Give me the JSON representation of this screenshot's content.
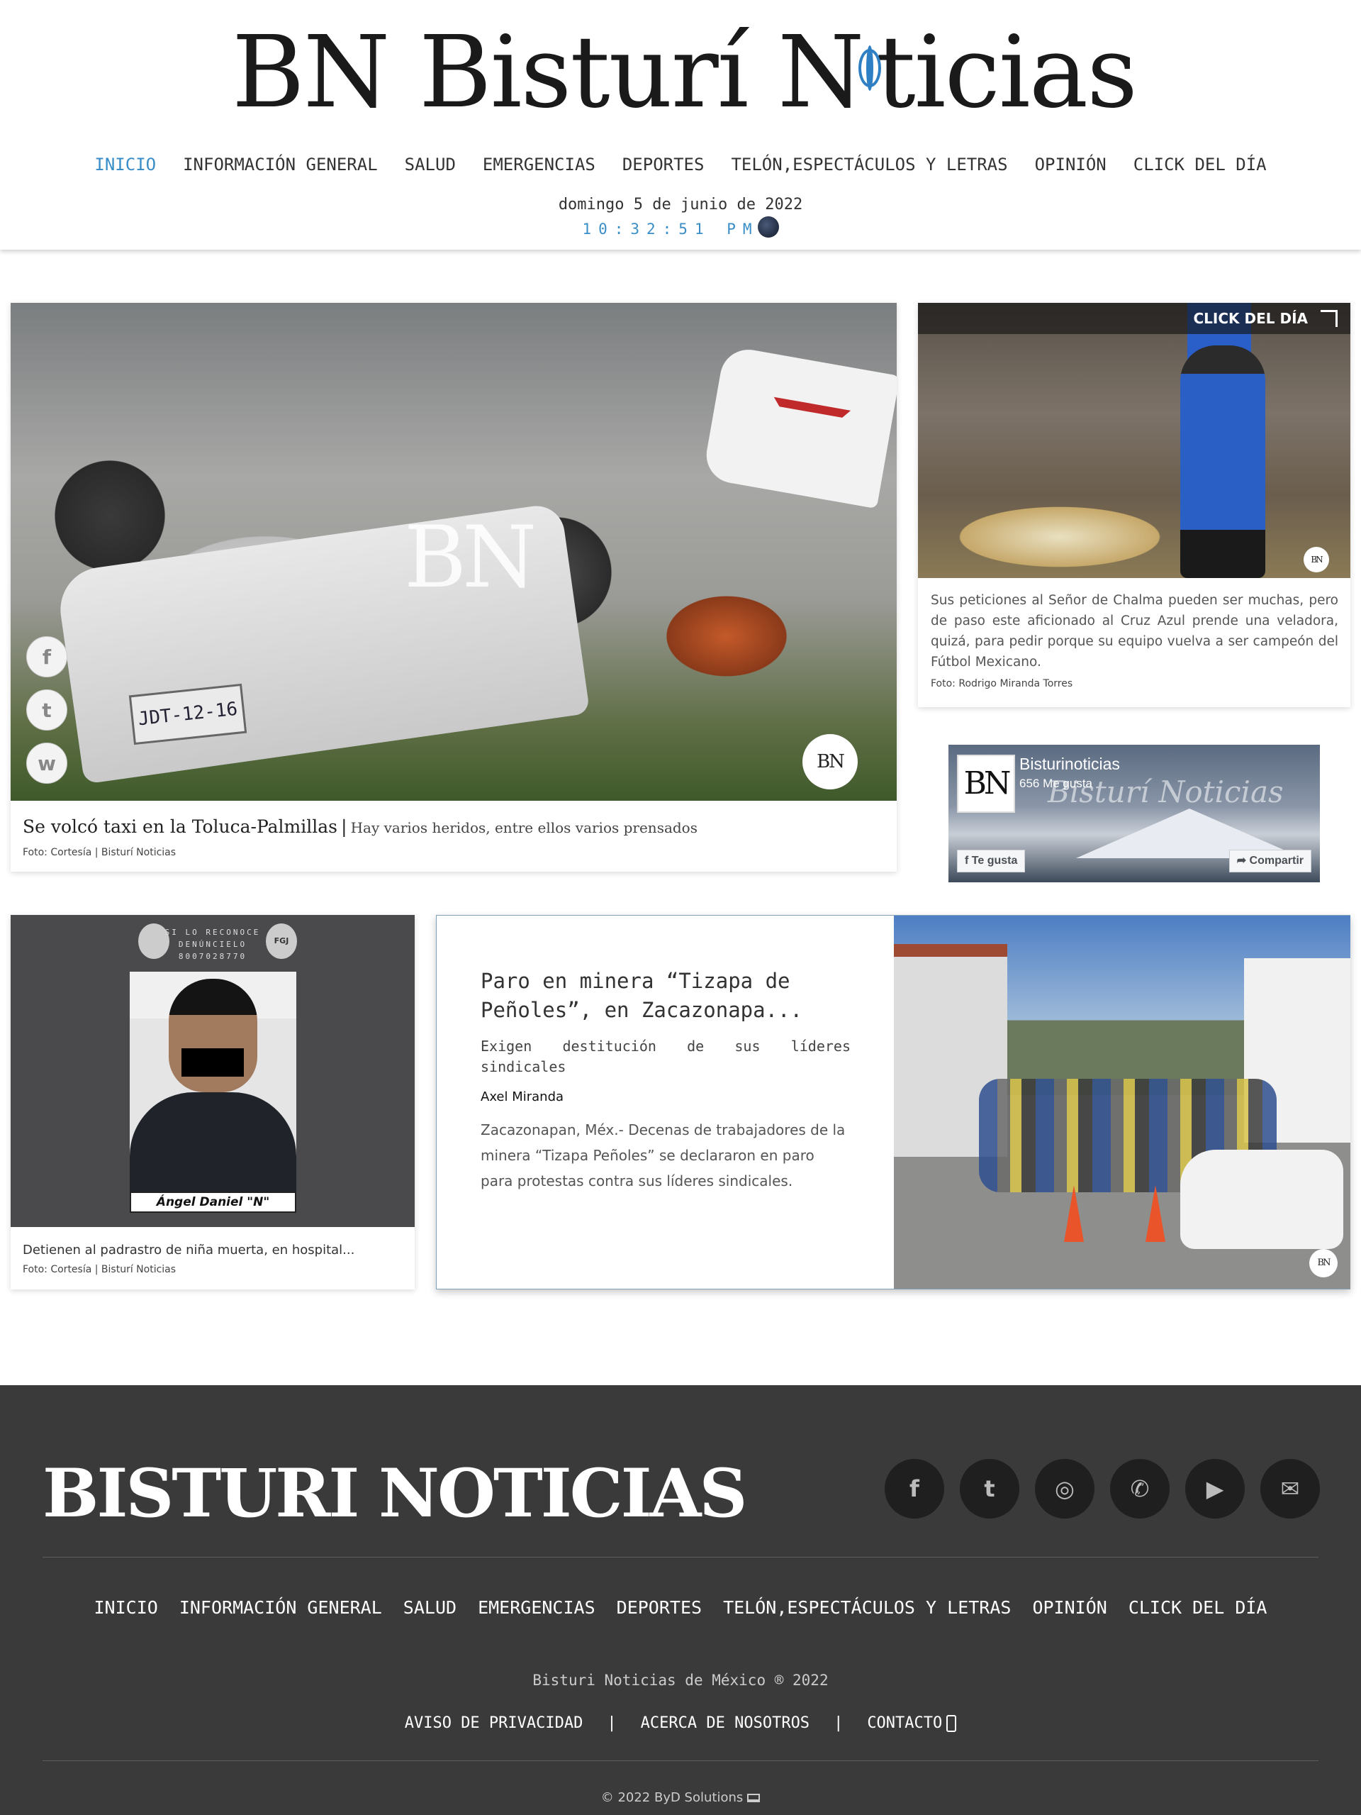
{
  "header": {
    "logo_text_left": "BN Bisturí N",
    "logo_text_right": "ticias",
    "nav": [
      "INICIO",
      "INFORMACIÓN GENERAL",
      "SALUD",
      "EMERGENCIAS",
      "DEPORTES",
      "TELÓN,ESPECTÁCULOS Y LETRAS",
      "OPINIÓN",
      "CLICK DEL DÍA"
    ],
    "date": "domingo 5 de junio de 2022",
    "time": "10:32:51 PM"
  },
  "feature": {
    "title": "Se volcó taxi en la Toluca-Palmillas",
    "separator": "|",
    "subtitle": "Hay varios heridos, entre ellos varios prensados",
    "credit": "Foto: Cortesía | Bisturí Noticias",
    "plate": "JDT-12-16",
    "watermark": "BN",
    "badge": "BN"
  },
  "click_del_dia": {
    "label": "CLICK DEL DÍA",
    "text": "Sus peticiones al Señor de Chalma pueden ser muchas, pero de paso este aficionado al Cruz Azul prende una veladora, quizá, para pedir porque su equipo vuelva a ser campeón del Fútbol Mexicano.",
    "credit": "Foto: Rodrigo Miranda Torres",
    "badge": "BN"
  },
  "facebook": {
    "page_name": "Bisturinoticias",
    "likes": "656 Me gusta",
    "cover_script": "Bisturí Noticias",
    "logo": "BN",
    "like_button": "Te gusta",
    "share_button": "Compartir"
  },
  "arrest": {
    "top_text": "SI LO RECONOCE DENÚNCIELO 8007028770",
    "seal_right": "FGJ",
    "name_tag": "Ángel Daniel \"N\"",
    "caption": "Detienen al padrastro de niña muerta, en hospital...",
    "credit": "Foto: Cortesía | Bisturí Noticias"
  },
  "story": {
    "title": "Paro en minera “Tizapa de Peñoles”, en Zacazonapa...",
    "lead": "Exigen destitución de sus líderes sindicales",
    "author": "Axel Miranda",
    "body": "Zacazonapan, Méx.- Decenas de trabajadores de la minera “Tizapa Peñoles” se declararon en paro para protestas contra sus líderes sindicales.",
    "badge": "BN"
  },
  "footer": {
    "brand": "BISTURI NOTICIAS",
    "socials": [
      "facebook-icon",
      "twitter-icon",
      "instagram-icon",
      "whatsapp-icon",
      "youtube-icon",
      "mail-icon"
    ],
    "nav": [
      "INICIO",
      "INFORMACIÓN GENERAL",
      "SALUD",
      "EMERGENCIAS",
      "DEPORTES",
      "TELÓN,ESPECTÁCULOS Y LETRAS",
      "OPINIÓN",
      "CLICK DEL DÍA"
    ],
    "copyright": "Bisturi Noticias de México ® 2022",
    "links": [
      "AVISO DE PRIVACIDAD",
      "ACERCA DE NOSOTROS",
      "CONTACTO"
    ],
    "link_separator": "|",
    "byline": "© 2022 ByD Solutions"
  },
  "colors": {
    "accent": "#3a8ec8",
    "footer_bg": "#3a3a3a",
    "footer_social_bg": "#1f1f1f"
  }
}
